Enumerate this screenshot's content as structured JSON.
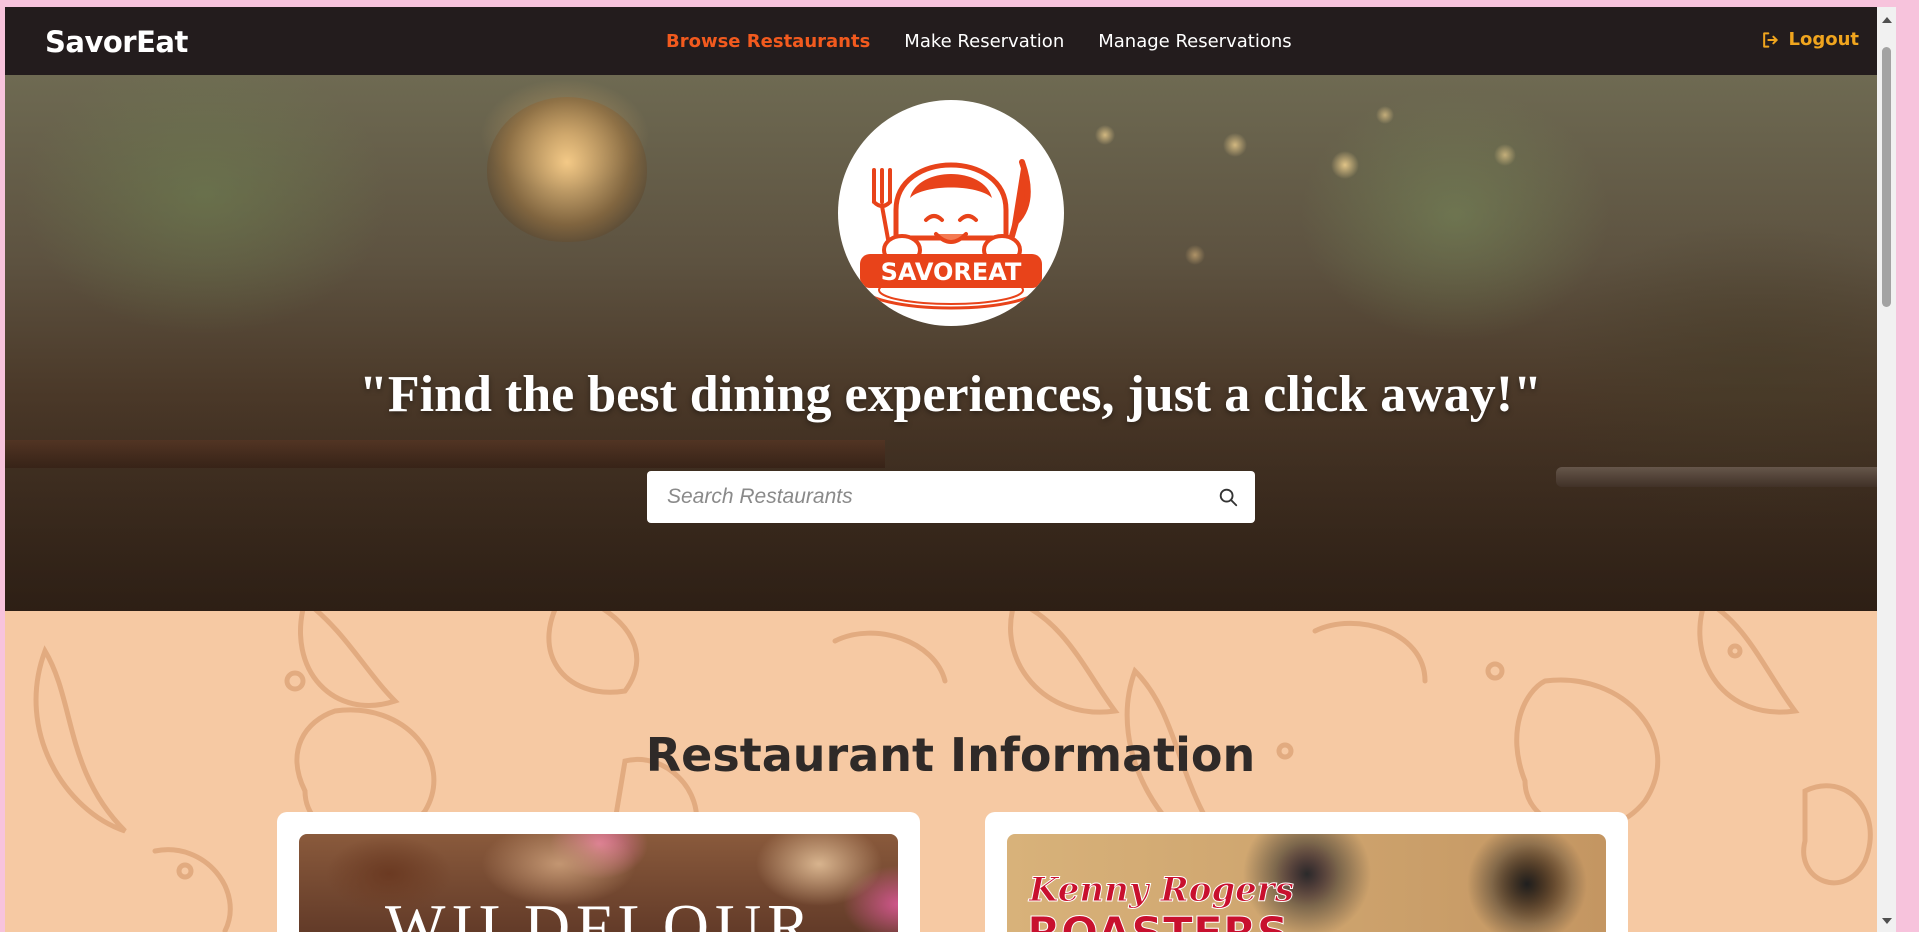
{
  "navbar": {
    "brand": "SavorEat",
    "links": [
      {
        "label": "Browse Restaurants",
        "active": true
      },
      {
        "label": "Make Reservation",
        "active": false
      },
      {
        "label": "Manage Reservations",
        "active": false
      }
    ],
    "logout_label": "Logout",
    "logout_icon": "logout-icon"
  },
  "hero": {
    "logo_text": "SAVOREAT",
    "tagline": "\"Find the best dining experiences, just a click away!\"",
    "search": {
      "placeholder": "Search Restaurants",
      "value": "",
      "icon": "search-icon"
    }
  },
  "section": {
    "title": "Restaurant Information"
  },
  "cards": [
    {
      "image_text": "WILDFLOUR"
    },
    {
      "image_text_1": "Kenny Rogers",
      "image_text_2": "ROASTERS"
    }
  ],
  "colors": {
    "navbar_bg": "#231c1d",
    "active_link": "#f25a1e",
    "logout": "#f0a51e",
    "content_bg": "#f6c9a3",
    "logo_red": "#e8431a"
  }
}
